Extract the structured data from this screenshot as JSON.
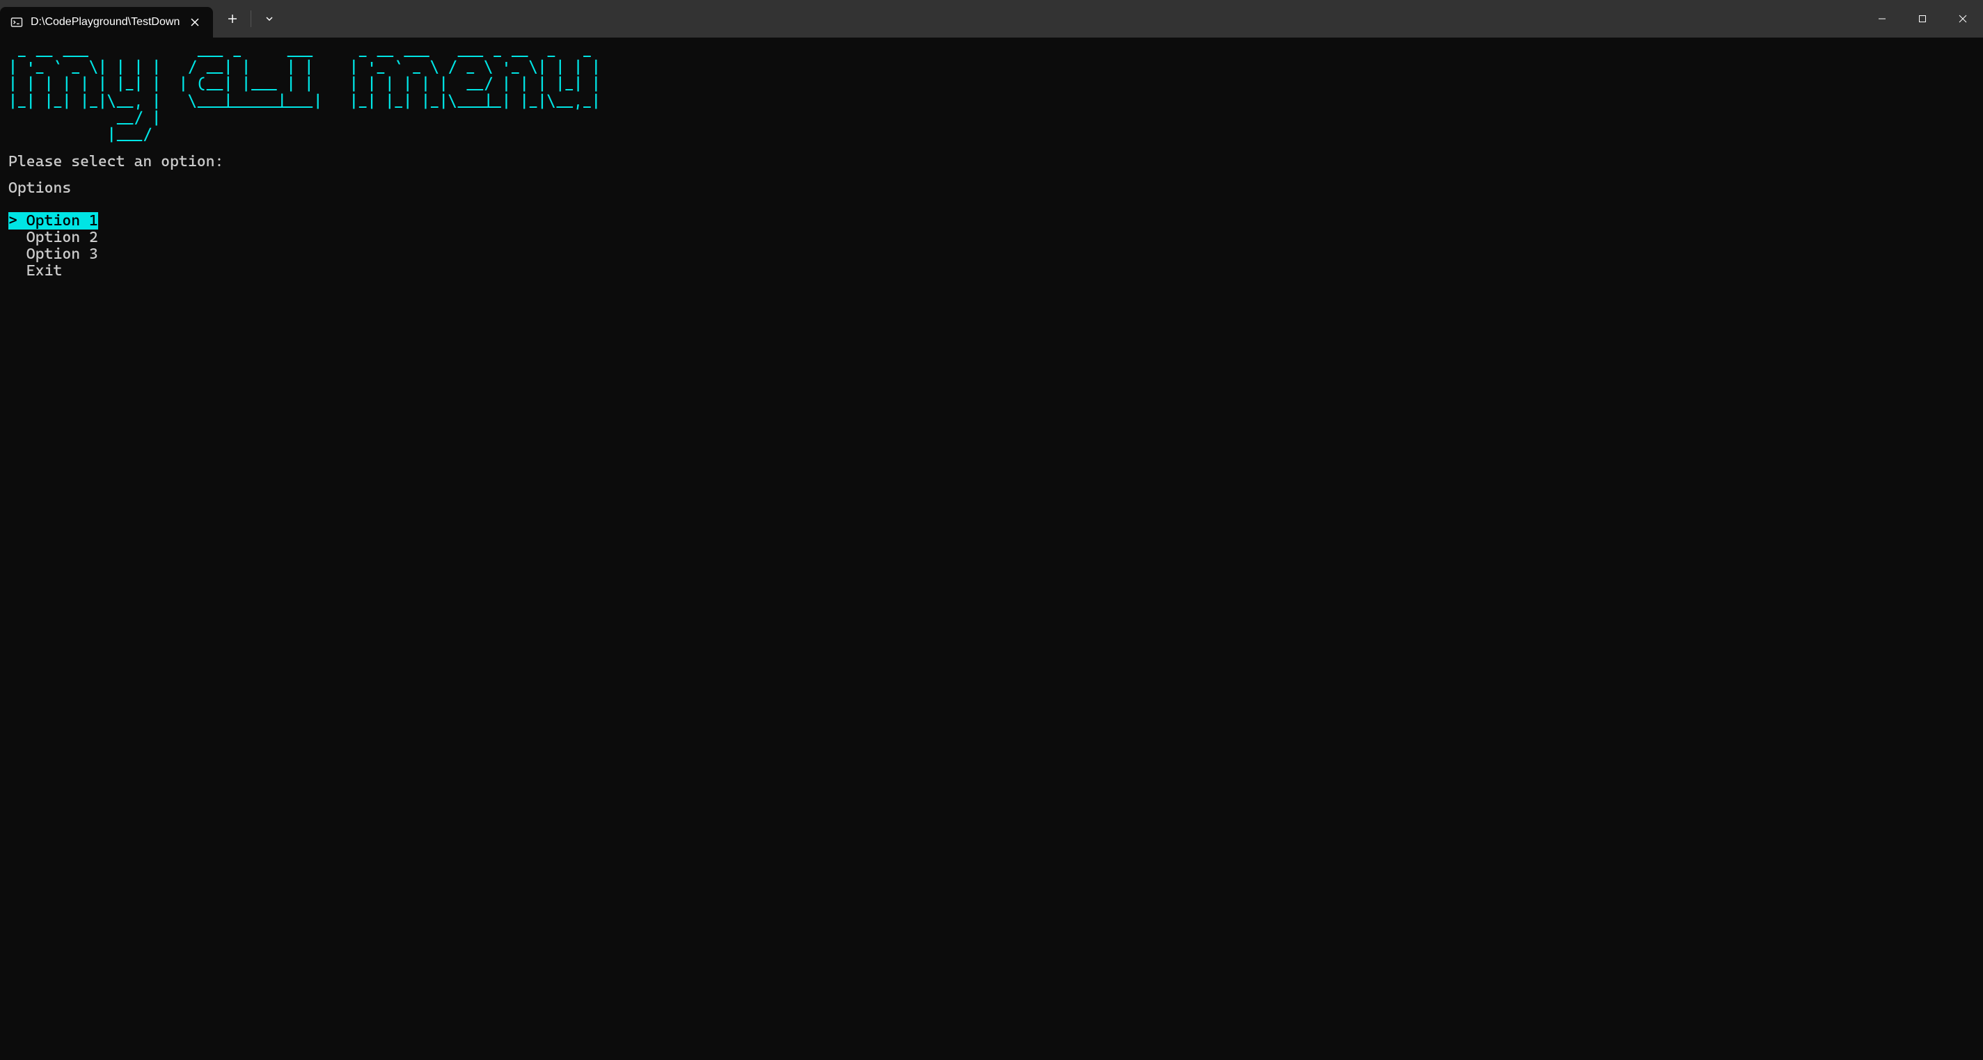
{
  "window": {
    "tab_title": "D:\\CodePlayground\\TestDown"
  },
  "ascii_art": " _ __ ___            ___ _     ___     _ __ ___   ___ _ __  _   _ \n| '_ ` _ \\| | | |   / __| |    | |    | '_ ` _ \\ / _ \\ '_ \\| | | |\n| | | | | | |_| |  | (__| |___ | |    | | | | | |  __/ | | | |_| |\n|_| |_| |_|\\__, |   \\___|_____|___|   |_| |_| |_|\\___|_| |_|\\__,_|\n            __/ |\n           |___/",
  "prompt": {
    "select_text": "Please select an option:",
    "header": "Options"
  },
  "menu": {
    "items": [
      {
        "label": "Option 1",
        "selected": true
      },
      {
        "label": "Option 2",
        "selected": false
      },
      {
        "label": "Option 3",
        "selected": false
      },
      {
        "label": "Exit",
        "selected": false
      }
    ]
  }
}
